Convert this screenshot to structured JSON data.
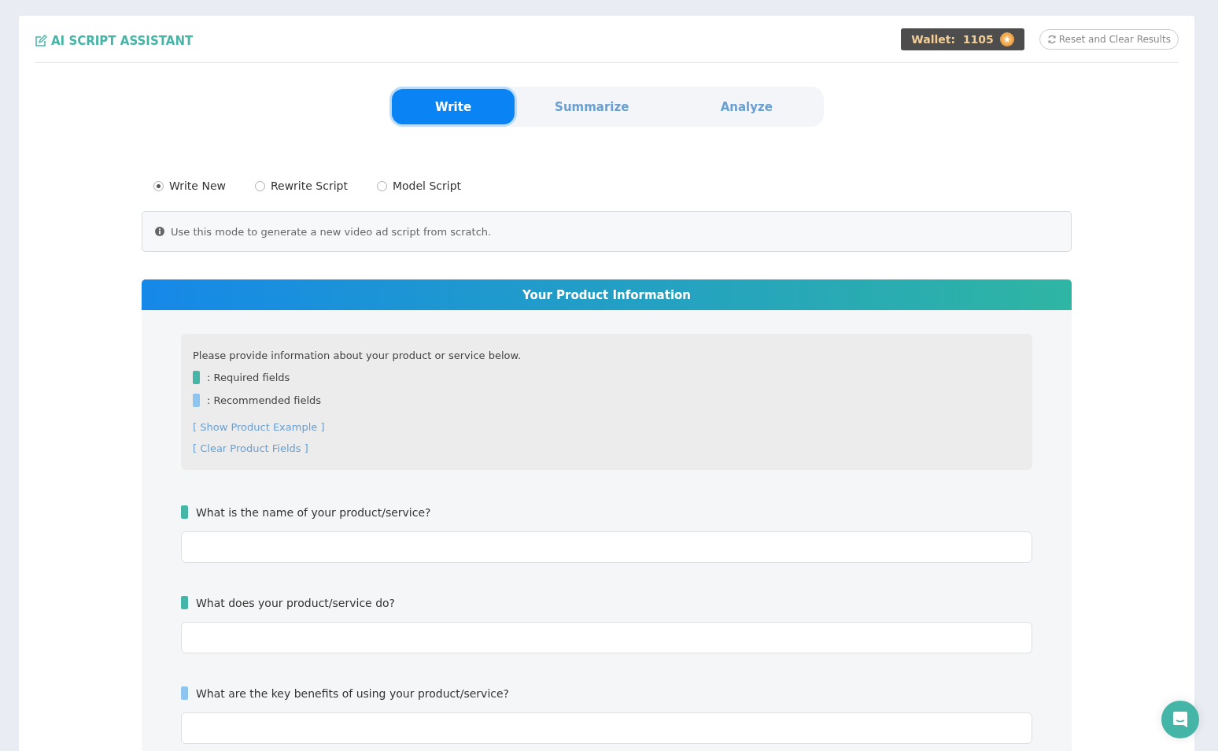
{
  "header": {
    "title": "AI SCRIPT ASSISTANT",
    "wallet": "Wallet:  1105",
    "reset_button": "Reset and Clear Results"
  },
  "tabs": [
    {
      "label": "Write",
      "selected": true
    },
    {
      "label": "Summarize",
      "selected": false
    },
    {
      "label": "Analyze",
      "selected": false
    }
  ],
  "modes": [
    {
      "label": "Write New",
      "selected": true
    },
    {
      "label": "Rewrite Script",
      "selected": false
    },
    {
      "label": "Model Script",
      "selected": false
    }
  ],
  "info_note": "Use this mode to generate a new video ad script from scratch.",
  "section": {
    "title": "Your Product Information",
    "intro": "Please provide information about your product or service below.",
    "legend": [
      {
        "kind": "required",
        "label": ": Required fields"
      },
      {
        "kind": "recommended",
        "label": ": Recommended fields"
      }
    ],
    "links": [
      "[ Show Product Example ]",
      "[ Clear Product Fields ]"
    ],
    "fields": [
      {
        "kind": "required",
        "label": "What is the name of your product/service?"
      },
      {
        "kind": "required",
        "label": "What does your product/service do?"
      },
      {
        "kind": "recommended",
        "label": "What are the key benefits of using your product/service?"
      }
    ]
  }
}
